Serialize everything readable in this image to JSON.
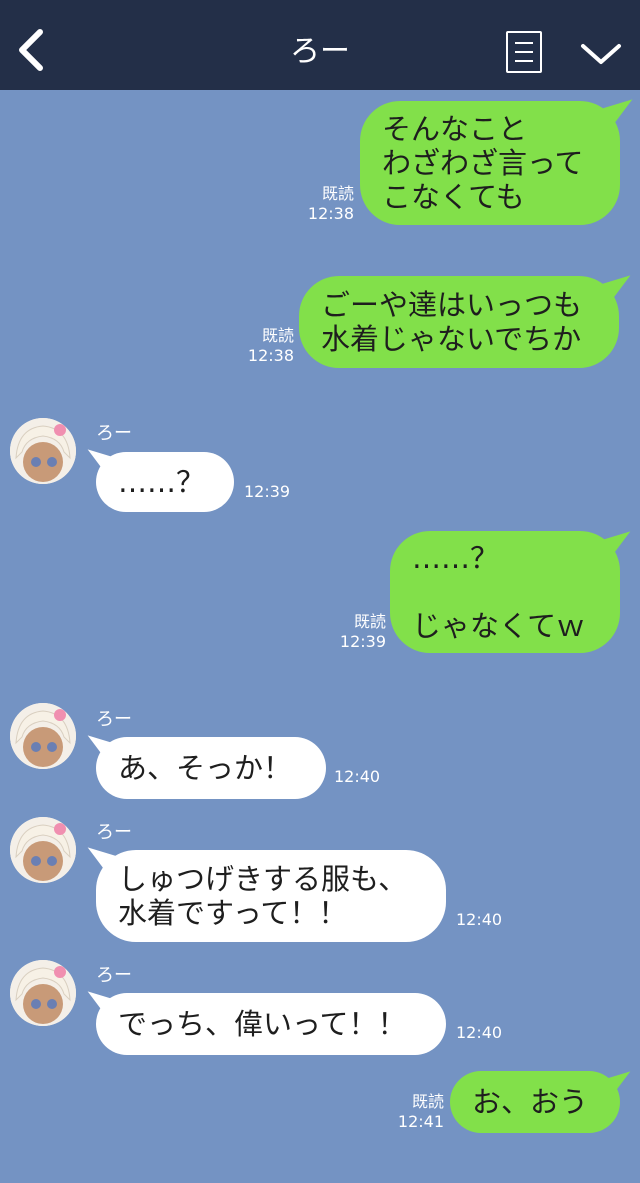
{
  "header": {
    "title": "ろー",
    "back_icon": "chevron-left-icon",
    "menu_icon": "menu-icon",
    "collapse_icon": "chevron-down-icon",
    "background": "#232f48"
  },
  "colors": {
    "background": "#7493c3",
    "outgoing_bubble": "#82e04a",
    "incoming_bubble": "#ffffff"
  },
  "messages": [
    {
      "direction": "out",
      "text": "そんなこと\nわざわざ言って\nこなくても",
      "read": "既読",
      "time": "12:38"
    },
    {
      "direction": "out",
      "text": "ごーや達はいっつも\n水着じゃないでちか",
      "read": "既読",
      "time": "12:38"
    },
    {
      "direction": "in",
      "sender": "ろー",
      "text": "……？",
      "time": "12:39"
    },
    {
      "direction": "out",
      "text": "……？\n\nじゃなくてｗ",
      "read": "既読",
      "time": "12:39"
    },
    {
      "direction": "in",
      "sender": "ろー",
      "text": "あ、そっか！",
      "time": "12:40"
    },
    {
      "direction": "in",
      "sender": "ろー",
      "text": "しゅつげきする服も、\n水着ですって！！",
      "time": "12:40"
    },
    {
      "direction": "in",
      "sender": "ろー",
      "text": "でっち、偉いって！！",
      "time": "12:40"
    },
    {
      "direction": "out",
      "text": "お、おう",
      "read": "既読",
      "time": "12:41"
    }
  ]
}
